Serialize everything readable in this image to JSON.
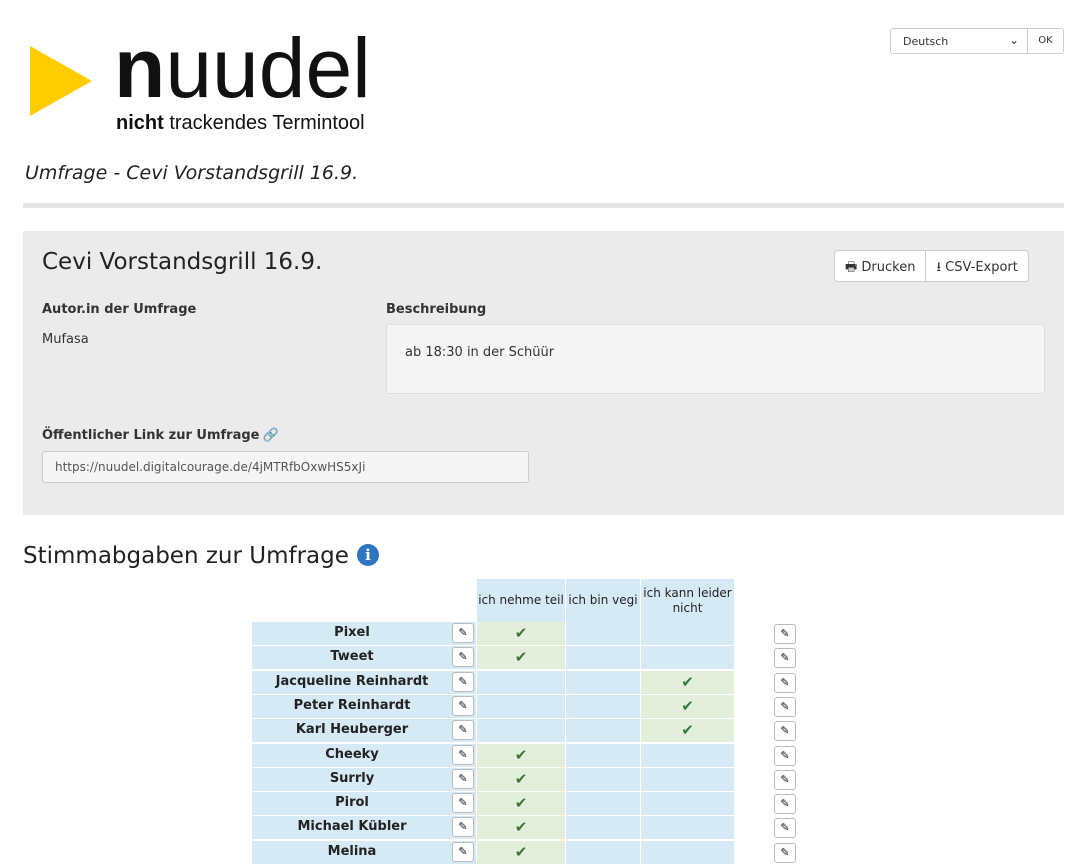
{
  "logo": {
    "wordmark_bold": "n",
    "wordmark_rest": "uudel",
    "tagline_bold": "nicht",
    "tagline_rest": " trackendes Termintool",
    "accent_color": "#ffcc00"
  },
  "language": {
    "selected": "Deutsch",
    "ok_label": "OK"
  },
  "page_heading": "Umfrage - Cevi Vorstandsgrill 16.9.",
  "poll": {
    "title": "Cevi Vorstandsgrill 16.9.",
    "print_label": "Drucken",
    "export_label": "CSV-Export",
    "author_label": "Autor.in der Umfrage",
    "author": "Mufasa",
    "description_label": "Beschreibung",
    "description": "ab 18:30 in der Schüür",
    "public_link_label": "Öffentlicher Link zur Umfrage",
    "public_link": "https://nuudel.digitalcourage.de/4jMTRfbOxwHS5xJi"
  },
  "votes": {
    "heading": "Stimmabgaben zur Umfrage",
    "choices": [
      "ich nehme teil",
      "ich bin vegi",
      "ich kann leider nicht"
    ],
    "rows": [
      {
        "name": "Pixel",
        "answers": [
          true,
          false,
          false
        ]
      },
      {
        "name": "Tweet",
        "answers": [
          true,
          false,
          false
        ]
      },
      {
        "name": "Jacqueline Reinhardt",
        "answers": [
          false,
          false,
          true
        ]
      },
      {
        "name": "Peter Reinhardt",
        "answers": [
          false,
          false,
          true
        ]
      },
      {
        "name": "Karl Heuberger",
        "answers": [
          false,
          false,
          true
        ]
      },
      {
        "name": "Cheeky",
        "answers": [
          true,
          false,
          false
        ]
      },
      {
        "name": "Surrly",
        "answers": [
          true,
          false,
          false
        ]
      },
      {
        "name": "Pirol",
        "answers": [
          true,
          false,
          false
        ]
      },
      {
        "name": "Michael Kübler",
        "answers": [
          true,
          false,
          false
        ]
      },
      {
        "name": "Melina",
        "answers": [
          true,
          false,
          false
        ]
      }
    ],
    "yes_color": "#e3eedb",
    "no_color": "#d5eaf5",
    "check_color": "#3c763d"
  }
}
